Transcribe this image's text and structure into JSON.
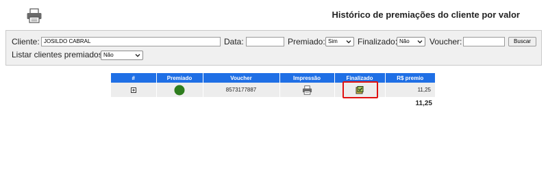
{
  "header": {
    "title": "Histórico de premiações do cliente por valor",
    "print_icon": "printer-icon"
  },
  "filters": {
    "cliente_label": "Cliente:",
    "cliente_value": "JOSILDO CABRAL",
    "data_label": "Data:",
    "data_value": "",
    "premiado_label": "Premiado:",
    "premiado_value": "Sim",
    "finalizado_label": "Finalizado:",
    "finalizado_value": "Não",
    "voucher_label": "Voucher:",
    "voucher_value": "",
    "buscar_label": "Buscar",
    "listar_label": "Listar clientes premiados:",
    "listar_value": "Não"
  },
  "table": {
    "columns": [
      "#",
      "Premiado",
      "Voucher",
      "Impressão",
      "Finalizado",
      "R$ premio"
    ],
    "rows": [
      {
        "expand_icon": "plus-box-icon",
        "premiado_icon": "green-circle-icon",
        "voucher": "8573177887",
        "impressao_icon": "printer-icon",
        "finalizado_icon": "finalized-stamp-icon",
        "premio": "11,25"
      }
    ],
    "total": "11,25"
  },
  "colors": {
    "header_blue": "#1f6fe5",
    "status_green": "#2e7d1e",
    "highlight_red": "#e01010"
  }
}
